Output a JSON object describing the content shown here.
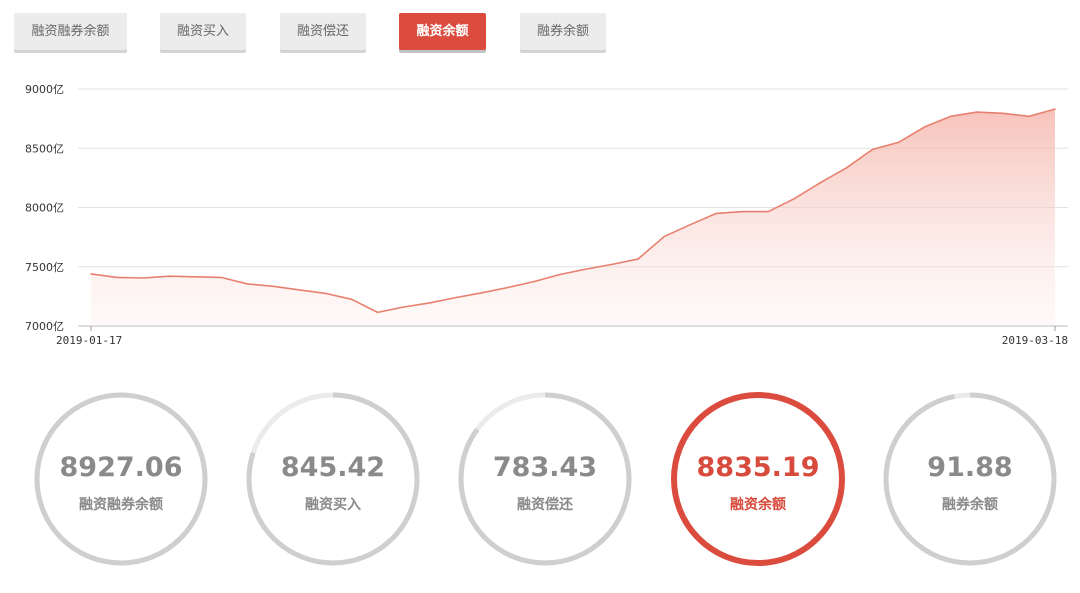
{
  "tabs": [
    {
      "label": "融资融券余额",
      "active": false
    },
    {
      "label": "融资买入",
      "active": false
    },
    {
      "label": "融资偿还",
      "active": false
    },
    {
      "label": "融资余额",
      "active": true
    },
    {
      "label": "融券余额",
      "active": false
    }
  ],
  "colors": {
    "accent": "#db4c3f",
    "line": "#e8806f",
    "ring_inactive": "#cfcfcf",
    "ring_track": "#ebebeb",
    "text_muted": "#8a8a8a"
  },
  "chart_data": {
    "type": "area",
    "title": "",
    "xlabel": "",
    "ylabel": "",
    "ylim": [
      7000,
      9000
    ],
    "yticks": [
      7000,
      7500,
      8000,
      8500,
      9000
    ],
    "ytick_labels": [
      "7000亿",
      "7500亿",
      "8000亿",
      "8500亿",
      "9000亿"
    ],
    "xtick_labels": [
      "2019-01-17",
      "2019-03-18"
    ],
    "grid": true,
    "series": [
      {
        "values": [
          7440,
          7410,
          7405,
          7420,
          7415,
          7410,
          7355,
          7335,
          7305,
          7275,
          7225,
          7115,
          7160,
          7195,
          7240,
          7280,
          7325,
          7375,
          7435,
          7480,
          7520,
          7565,
          7755,
          7855,
          7950,
          7965,
          7965,
          8075,
          8210,
          8335,
          8490,
          8550,
          8680,
          8770,
          8805,
          8795,
          8770,
          8830
        ]
      }
    ]
  },
  "summary": [
    {
      "value": "8927.06",
      "label": "融资融券余额",
      "active": false,
      "fraction": 1.0
    },
    {
      "value": "845.42",
      "label": "融资买入",
      "active": false,
      "fraction": 0.8
    },
    {
      "value": "783.43",
      "label": "融资偿还",
      "active": false,
      "fraction": 0.85
    },
    {
      "value": "8835.19",
      "label": "融资余额",
      "active": true,
      "fraction": 1.0
    },
    {
      "value": "91.88",
      "label": "融券余额",
      "active": false,
      "fraction": 0.97
    }
  ]
}
